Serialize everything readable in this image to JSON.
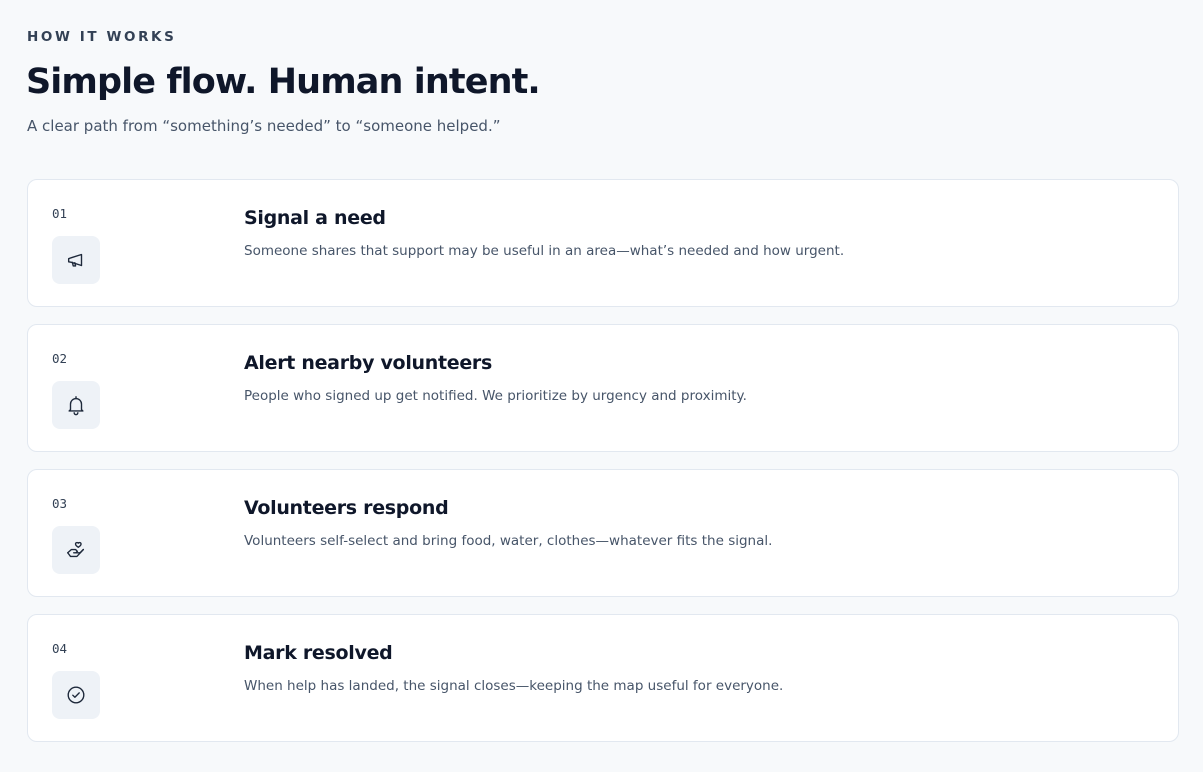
{
  "section": {
    "eyebrow": "HOW IT WORKS",
    "title": "Simple flow. Human intent.",
    "subtitle": "A clear path from “something’s needed” to “someone helped.”"
  },
  "steps": [
    {
      "number": "01",
      "icon": "megaphone-icon",
      "title": "Signal a need",
      "description": "Someone shares that support may be useful in an area—what’s needed and how urgent."
    },
    {
      "number": "02",
      "icon": "bell-icon",
      "title": "Alert nearby volunteers",
      "description": "People who signed up get notified. We prioritize by urgency and proximity."
    },
    {
      "number": "03",
      "icon": "helping-hand-icon",
      "title": "Volunteers respond",
      "description": "Volunteers self-select and bring food, water, clothes—whatever fits the signal."
    },
    {
      "number": "04",
      "icon": "check-circle-icon",
      "title": "Mark resolved",
      "description": "When help has landed, the signal closes—keeping the map useful for everyone."
    }
  ]
}
